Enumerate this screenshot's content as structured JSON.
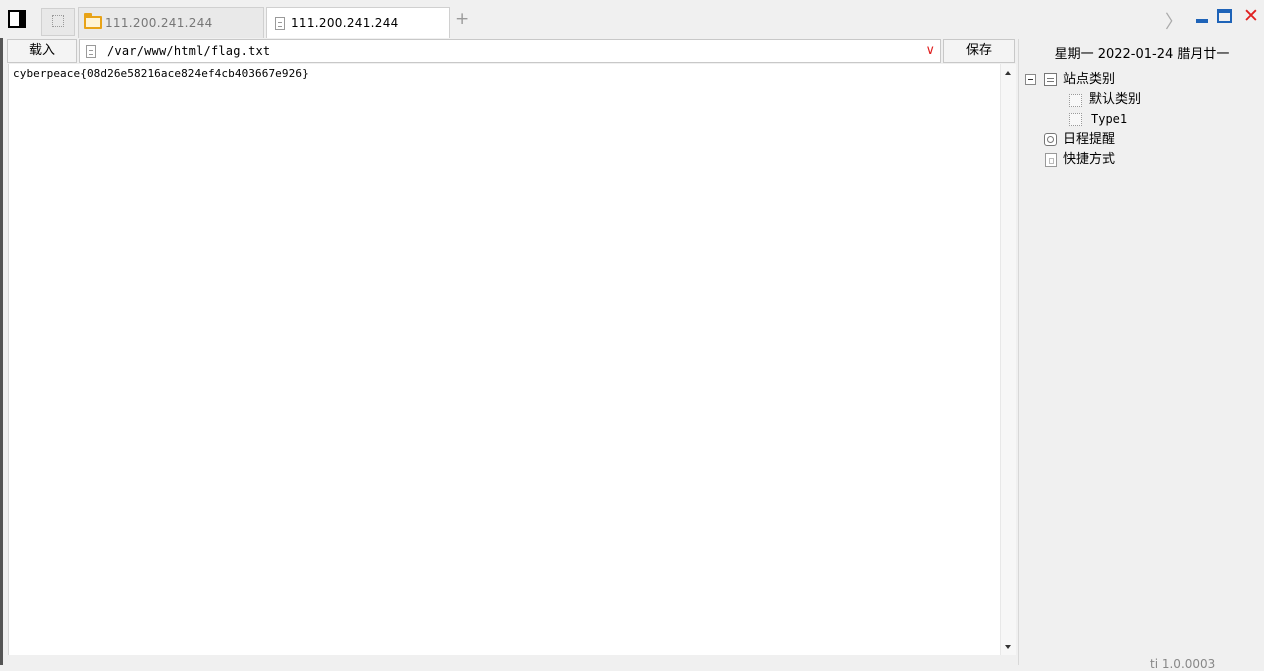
{
  "tabs": {
    "items": [
      {
        "label": "111.200.241.244",
        "icon": "folder-icon",
        "active": false
      },
      {
        "label": "111.200.241.244",
        "icon": "file-icon",
        "active": true
      }
    ],
    "add_label": "+"
  },
  "window_controls": {
    "chevron": "〉",
    "close": "✕"
  },
  "toolbar": {
    "load_label": "载入",
    "path_value": "/var/www/html/flag.txt",
    "dropdown_glyph": "∨",
    "save_label": "保存"
  },
  "editor": {
    "content": "cyberpeace{08d26e58216ace824ef4cb403667e926}"
  },
  "sidepanel": {
    "date": "星期一 2022-01-24 腊月廿一",
    "tree": {
      "site_category": "站点类别",
      "default_category": "默认类别",
      "type1": "Type1",
      "schedule_reminder": "日程提醒",
      "shortcuts": "快捷方式"
    }
  },
  "statusbar": {
    "text": "ti 1.0.0003"
  },
  "colors": {
    "accent_blue": "#1e63b8",
    "close_red": "#e02020",
    "folder_yellow": "#e8a317"
  }
}
